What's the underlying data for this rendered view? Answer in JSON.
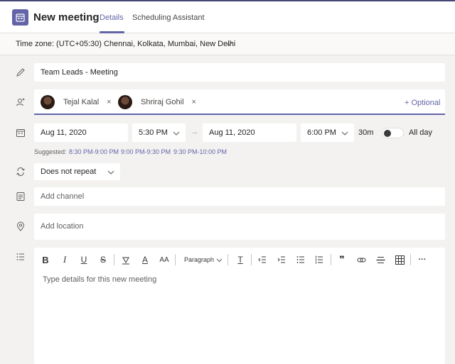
{
  "header": {
    "title": "New meeting",
    "tabs": [
      {
        "label": "Details",
        "active": true
      },
      {
        "label": "Scheduling Assistant",
        "active": false
      }
    ],
    "accent_color": "#6264a7"
  },
  "timezone": {
    "label": "Time zone: (UTC+05:30) Chennai, Kolkata, Mumbai, New Delhi"
  },
  "title_field": {
    "value": "Team Leads - Meeting"
  },
  "attendees": {
    "people": [
      {
        "name": "Tejal Kalal"
      },
      {
        "name": "Shriraj Gohil"
      }
    ],
    "remove_glyph": "×",
    "optional_label": "+ Optional"
  },
  "datetime": {
    "start_date": "Aug 11, 2020",
    "start_time": "5:30 PM",
    "arrow": "→",
    "end_date": "Aug 11, 2020",
    "end_time": "6:00 PM",
    "duration": "30m",
    "all_day_label": "All day",
    "all_day_on": false
  },
  "suggested": {
    "label": "Suggested:",
    "slots": [
      "8:30 PM-9:00 PM",
      "9:00 PM-9:30 PM",
      "9:30 PM-10:00 PM"
    ]
  },
  "repeat": {
    "value": "Does not repeat"
  },
  "channel": {
    "placeholder": "Add channel"
  },
  "location": {
    "placeholder": "Add location"
  },
  "editor": {
    "bold": "B",
    "italic": "I",
    "underline": "U",
    "strike": "S",
    "font_color": "A",
    "font_size": "AA",
    "paragraph": "Paragraph",
    "clear_format": "T",
    "quote": "❞",
    "more": "···",
    "placeholder": "Type details for this new meeting"
  }
}
